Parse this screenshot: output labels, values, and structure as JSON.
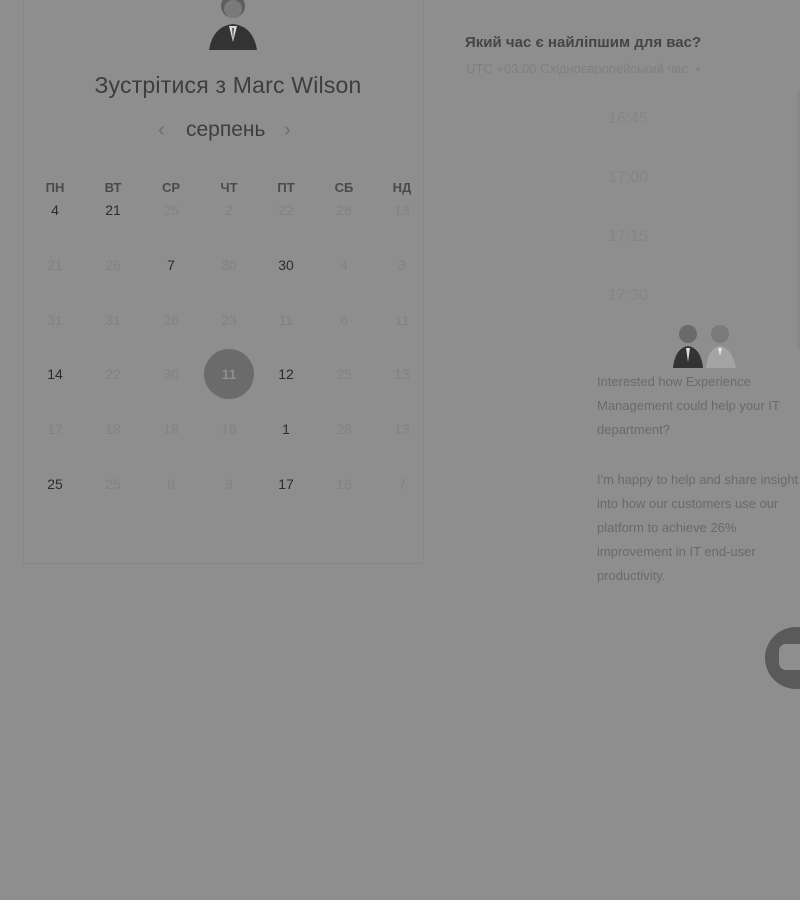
{
  "meeting": {
    "title": "Зустрітися з Marc Wilson"
  },
  "calendar": {
    "month": "серпень",
    "weekdays": [
      "ПН",
      "ВТ",
      "СР",
      "ЧТ",
      "ПТ",
      "СБ",
      "НД"
    ],
    "weeks": [
      [
        "4",
        "21",
        "25",
        "2",
        "22",
        "28",
        "13"
      ],
      [
        "21",
        "26",
        "7",
        "30",
        "30",
        "4",
        "3"
      ],
      [
        "31",
        "31",
        "26",
        "23",
        "11",
        "6",
        "11"
      ],
      [
        "14",
        "22",
        "30",
        "11",
        "12",
        "25",
        "13"
      ],
      [
        "17",
        "18",
        "18",
        "16",
        "1",
        "28",
        "13"
      ],
      [
        "25",
        "25",
        "8",
        "9",
        "17",
        "16",
        "7"
      ]
    ],
    "available": [
      [
        0,
        0
      ],
      [
        0,
        1
      ],
      [
        1,
        2
      ],
      [
        1,
        4
      ],
      [
        3,
        0
      ],
      [
        3,
        4
      ],
      [
        4,
        4
      ],
      [
        5,
        0
      ],
      [
        5,
        4
      ]
    ],
    "selected": [
      3,
      3
    ]
  },
  "times": {
    "question": "Який час є найліпшим для вас?",
    "timezone": "UTC +03:00 Східноєвропейський час",
    "slots": [
      "16:45",
      "17:00",
      "17:15",
      "17:30"
    ]
  },
  "chat": {
    "message1": "Interested how Experience Management could help your IT department?",
    "message2": "I'm happy to help and share insight into how our customers use our platform to achieve 26% improvement in IT end-user productivity."
  },
  "icons": {
    "prev": "chevron-left-icon",
    "next": "chevron-right-icon",
    "caret": "caret-down-icon",
    "chat": "chat-bubble-icon"
  }
}
